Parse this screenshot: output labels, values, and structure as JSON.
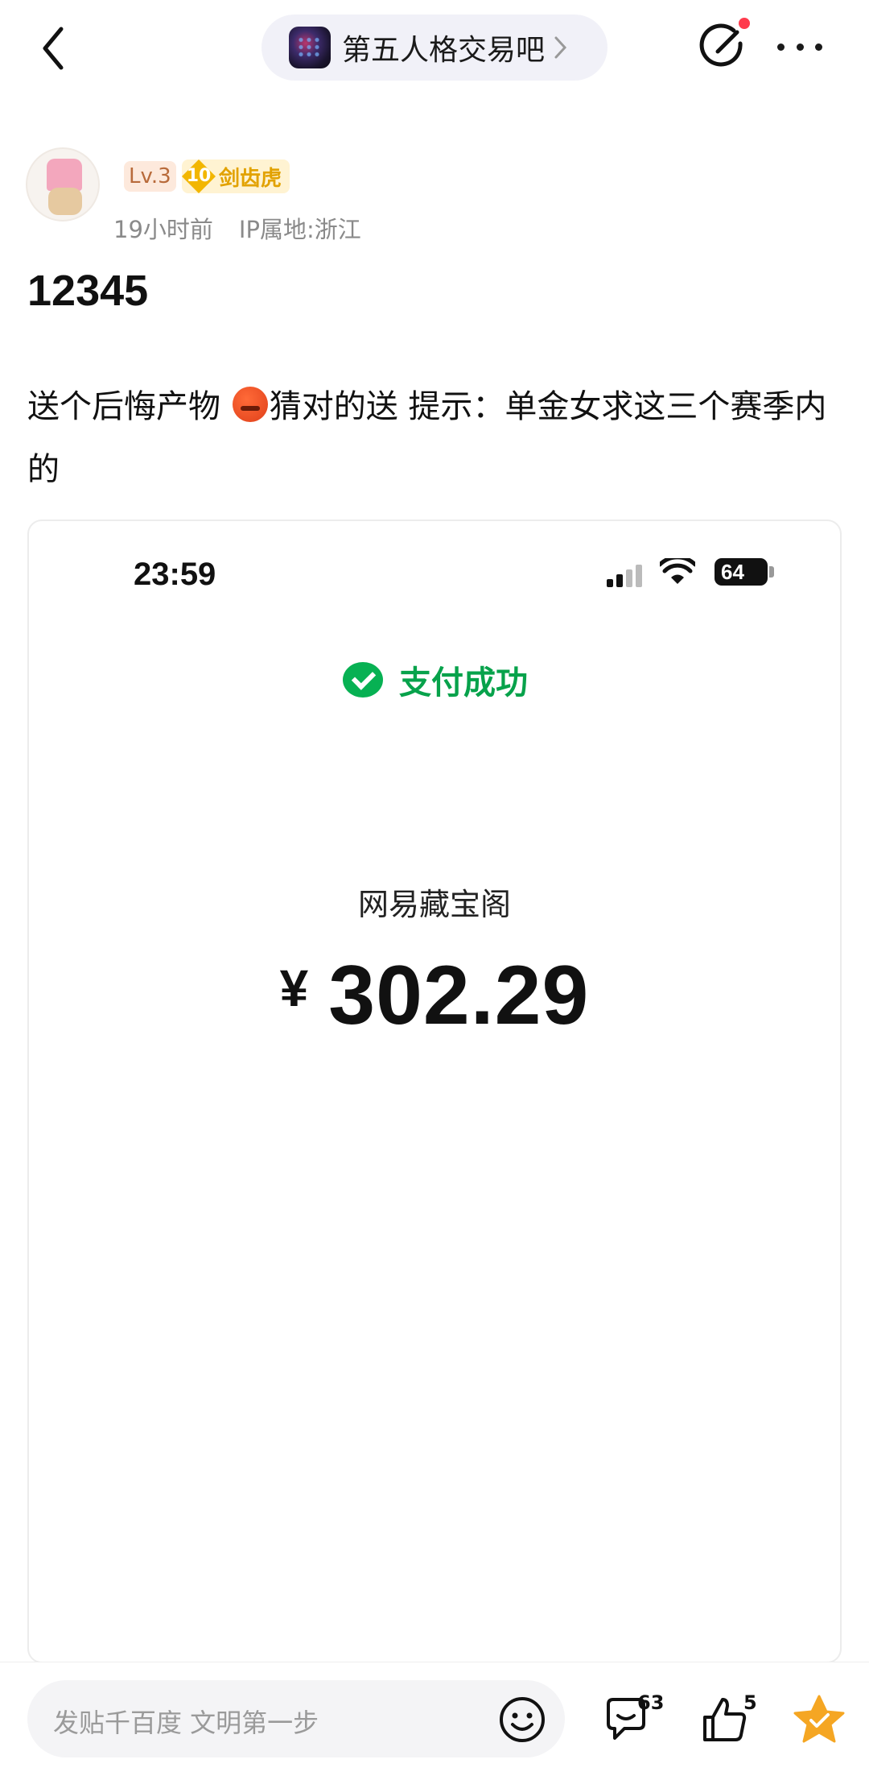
{
  "forum": {
    "name": "第五人格交易吧"
  },
  "author": {
    "level": "Lv.3",
    "badge_level": "10",
    "badge_name": "剑齿虎",
    "time": "19小时前",
    "ip": "IP属地:浙江"
  },
  "post": {
    "title": "12345",
    "text_before_emoji": "送个后悔产物 ",
    "text_after_emoji": "猜对的送 提示：单金女求这三个赛季内的"
  },
  "screenshot": {
    "time": "23:59",
    "battery": "64",
    "pay_status": "支付成功",
    "merchant": "网易藏宝阁",
    "currency": "¥",
    "amount": "302.29"
  },
  "bottom": {
    "reply_placeholder": "发贴千百度 文明第一步",
    "comment_count": "63",
    "like_count": "5"
  },
  "colors": {
    "wechat_green": "#07b153",
    "favorite_gold": "#f5a623",
    "notify_red": "#ff3b4d"
  },
  "icons": [
    "back-icon",
    "chevron-right-icon",
    "edit-icon",
    "more-icon",
    "emoji-icon",
    "comment-icon",
    "like-icon",
    "star-icon"
  ]
}
